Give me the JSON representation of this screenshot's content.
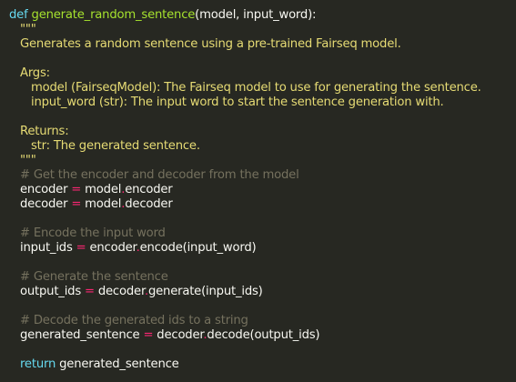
{
  "code": {
    "l1": {
      "keyword": "def",
      "sp": " ",
      "fname": "generate_random_sentence",
      "params": "(model, input_word):"
    },
    "l2": "\"\"\"",
    "l3": "Generates a random sentence using a pre-trained Fairseq model.",
    "l5": "Args:",
    "l6": "model (FairseqModel): The Fairseq model to use for generating the sentence.",
    "l7": "input_word (str): The input word to start the sentence generation with.",
    "l9": "Returns:",
    "l10": "str: The generated sentence.",
    "l11": "\"\"\"",
    "l12": "# Get the encoder and decoder from the model",
    "l13": {
      "lhs": "encoder ",
      "op": "=",
      "rhs_obj": " model",
      "dot": ".",
      "rhs_attr": "encoder"
    },
    "l14": {
      "lhs": "decoder ",
      "op": "=",
      "rhs_obj": " model",
      "dot": ".",
      "rhs_attr": "decoder"
    },
    "l16": "# Encode the input word",
    "l17": {
      "lhs": "input_ids ",
      "op": "=",
      "rhs_obj": " encoder",
      "dot": ".",
      "rhs_attr": "encode(input_word)"
    },
    "l19": "# Generate the sentence",
    "l20": {
      "lhs": "output_ids ",
      "op": "=",
      "rhs_obj": " decoder",
      "dot": ".",
      "rhs_attr": "generate(input_ids)"
    },
    "l22": "# Decode the generated ids to a string",
    "l23": {
      "lhs": "generated_sentence ",
      "op": "=",
      "rhs_obj": " decoder",
      "dot": ".",
      "rhs_attr": "decode(output_ids)"
    },
    "l25": {
      "keyword": "return",
      "value": " generated_sentence"
    }
  },
  "colors": {
    "background": "#272822",
    "keyword": "#66d9ef",
    "function": "#a6e22e",
    "docstring": "#e6db74",
    "comment": "#75715e",
    "operator": "#f92672",
    "text": "#f8f8f2"
  }
}
